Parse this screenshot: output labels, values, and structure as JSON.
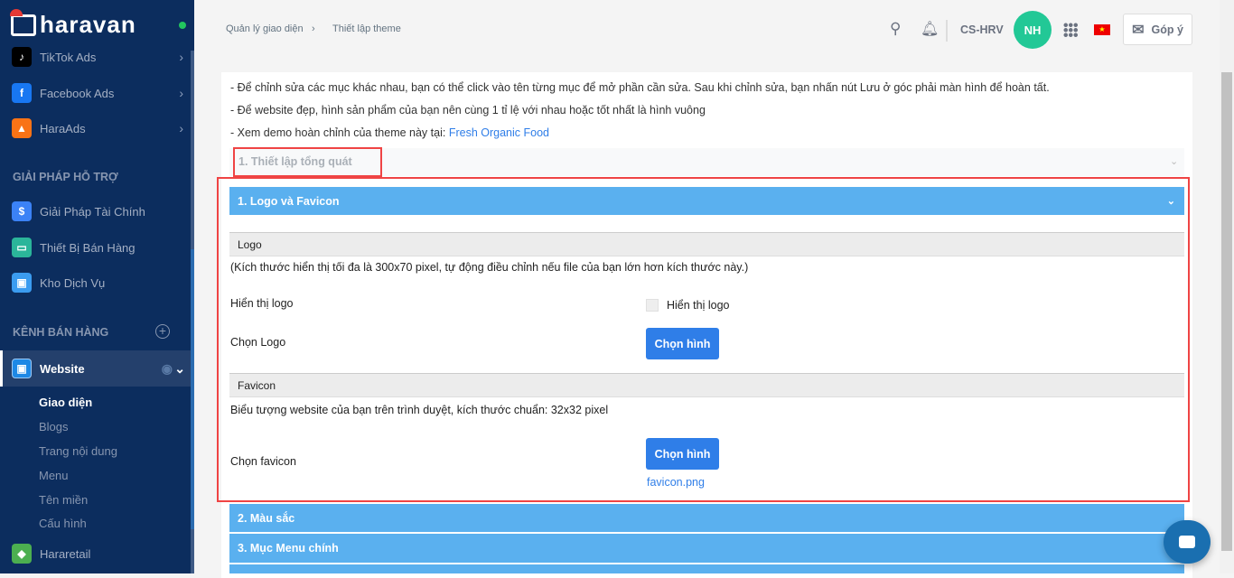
{
  "brand": "haravan",
  "sidebar": {
    "items_top": [
      {
        "label": "TikTok Ads",
        "icon": "tiktok-icon"
      },
      {
        "label": "Facebook Ads",
        "icon": "facebook-icon"
      },
      {
        "label": "HaraAds",
        "icon": "haraads-icon"
      }
    ],
    "support_heading": "GIẢI PHÁP HỖ TRỢ",
    "support_items": [
      {
        "label": "Giải Pháp Tài Chính"
      },
      {
        "label": "Thiết Bị Bán Hàng"
      },
      {
        "label": "Kho Dịch Vụ"
      }
    ],
    "channels_heading": "KÊNH BÁN HÀNG",
    "website": {
      "label": "Website",
      "subitems": [
        "Giao diện",
        "Blogs",
        "Trang nội dung",
        "Menu",
        "Tên miền",
        "Cấu hình"
      ]
    },
    "hararetail": "Hararetail"
  },
  "header": {
    "breadcrumb": [
      "Quản lý giao diện",
      "Thiết lập theme"
    ],
    "store": "CS-HRV",
    "avatar": "NH",
    "feedback": "Góp ý"
  },
  "intro": {
    "line1": "- Để chỉnh sửa các mục khác nhau, bạn có thể click vào tên từng mục để mở phần cần sửa. Sau khi chỉnh sửa, bạn nhấn nút Lưu ở góc phải màn hình để hoàn tất.",
    "line2": "- Để website đẹp, hình sản phẩm của bạn nên cùng 1 tỉ lệ với nhau hoặc tốt nhất là hình vuông",
    "line3": "- Xem demo hoàn chỉnh của theme này tại: ",
    "demo_link": "Fresh Organic Food"
  },
  "general_section": "1. Thiết lập tổng quát",
  "logo_section": {
    "title": "1. Logo và Favicon",
    "logo_heading": "Logo",
    "logo_note": "(Kích thước hiển thị tối đa là 300x70 pixel, tự động điều chỉnh nếu file của bạn lớn hơn kích thước này.)",
    "show_logo_label": "Hiển thị logo",
    "show_logo_checkbox": "Hiển thị logo",
    "show_logo_checked": false,
    "choose_logo_label": "Chọn Logo",
    "choose_button": "Chọn hình",
    "favicon_heading": "Favicon",
    "favicon_note": "Biểu tượng website của bạn trên trình duyệt, kích thước chuẩn: 32x32 pixel",
    "choose_favicon_label": "Chọn favicon",
    "favicon_file": "favicon.png"
  },
  "other_sections": [
    "2. Màu sắc",
    "3. Mục Menu chính"
  ]
}
